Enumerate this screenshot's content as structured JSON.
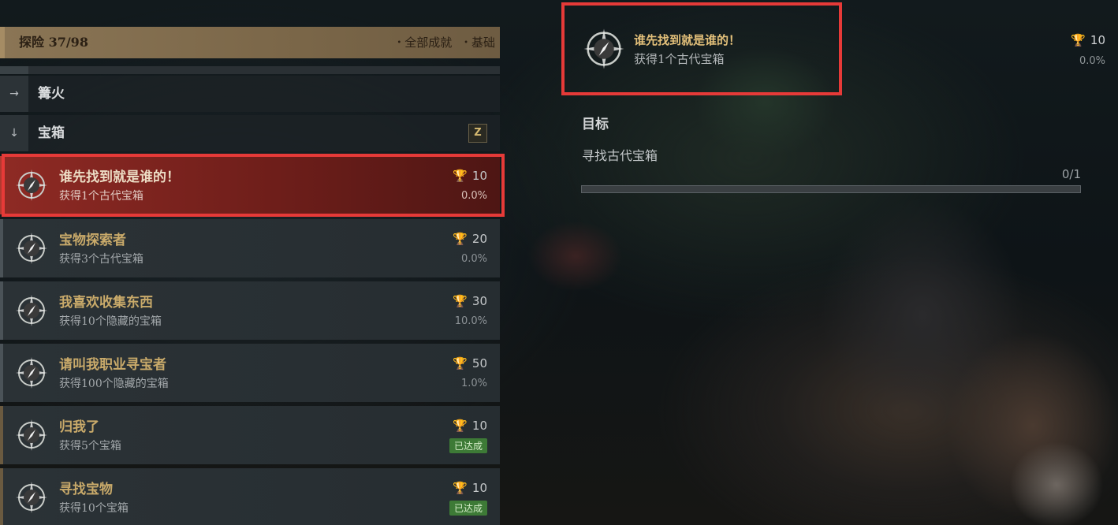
{
  "header": {
    "title": "探险 37/98",
    "links": [
      "全部成就",
      "基础"
    ]
  },
  "categories": [
    {
      "arrow": "→",
      "label": "篝火"
    },
    {
      "arrow": "↓",
      "label": "宝箱",
      "key": "Z"
    }
  ],
  "achievements": [
    {
      "title": "谁先找到就是谁的！",
      "desc": "获得1个古代宝箱",
      "points": "10",
      "percent": "0.0%",
      "selected": true
    },
    {
      "title": "宝物探索者",
      "desc": "获得3个古代宝箱",
      "points": "20",
      "percent": "0.0%"
    },
    {
      "title": "我喜欢收集东西",
      "desc": "获得10个隐藏的宝箱",
      "points": "30",
      "percent": "10.0%"
    },
    {
      "title": "请叫我职业寻宝者",
      "desc": "获得100个隐藏的宝箱",
      "points": "50",
      "percent": "1.0%"
    },
    {
      "title": "归我了",
      "desc": "获得5个宝箱",
      "points": "10",
      "status": "已达成"
    },
    {
      "title": "寻找宝物",
      "desc": "获得10个宝箱",
      "points": "10",
      "status": "已达成"
    }
  ],
  "detail": {
    "title": "谁先找到就是谁的！",
    "desc": "获得1个古代宝箱",
    "points": "10",
    "percent": "0.0%",
    "goal_heading": "目标",
    "goal_text": "寻找古代宝箱",
    "progress_text": "0/1",
    "progress_fraction": 0
  },
  "icons": {
    "achievement": "compass-icon",
    "points": "trophy-icon"
  },
  "colors": {
    "accent_gold": "#c49a2c",
    "selected_red": "#8e2a24",
    "highlight_box": "#e63a38",
    "completed_green": "#3d7a36"
  }
}
